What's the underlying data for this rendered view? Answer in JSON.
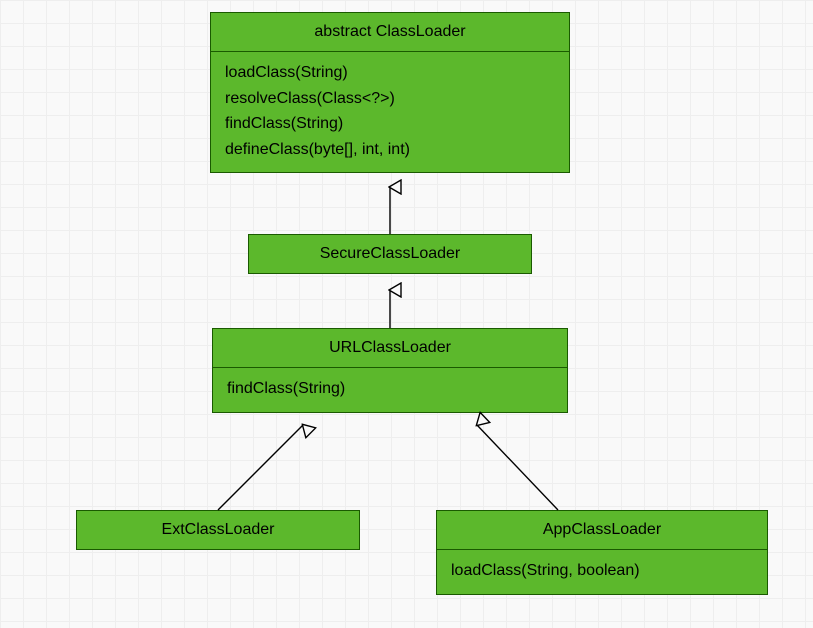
{
  "classes": {
    "classloader": {
      "title": "abstract ClassLoader",
      "methods": [
        "loadClass(String)",
        "resolveClass(Class<?>)",
        "findClass(String)",
        "defineClass(byte[], int, int)"
      ]
    },
    "secureclassloader": {
      "title": "SecureClassLoader"
    },
    "urlclassloader": {
      "title": "URLClassLoader",
      "methods": [
        "findClass(String)"
      ]
    },
    "extclassloader": {
      "title": "ExtClassLoader"
    },
    "appclassloader": {
      "title": "AppClassLoader",
      "methods": [
        "loadClass(String, boolean)"
      ]
    }
  },
  "relationships": [
    {
      "from": "SecureClassLoader",
      "to": "ClassLoader",
      "type": "generalization"
    },
    {
      "from": "URLClassLoader",
      "to": "SecureClassLoader",
      "type": "generalization"
    },
    {
      "from": "ExtClassLoader",
      "to": "URLClassLoader",
      "type": "generalization"
    },
    {
      "from": "AppClassLoader",
      "to": "URLClassLoader",
      "type": "generalization"
    }
  ]
}
